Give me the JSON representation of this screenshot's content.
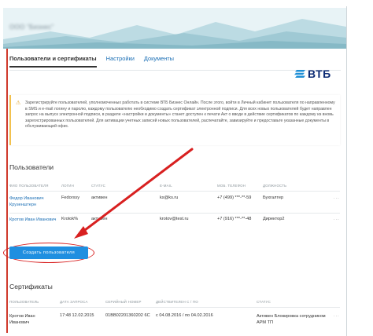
{
  "banner": {
    "title": "ООО \"Бизнес\""
  },
  "tabs": [
    {
      "label": "Пользователи и сертификаты",
      "active": true
    },
    {
      "label": "Настройки",
      "active": false
    },
    {
      "label": "Документы",
      "active": false
    }
  ],
  "logo": {
    "text": "ВТБ",
    "icon": "vtb-stripes-icon"
  },
  "notice": {
    "icon": "warning-icon",
    "text": "Зарегистрируйте пользователей, уполномоченных работать в системе ВТБ Бизнес Онлайн. После этого, войти в Личный кабинет пользователя по направленному в SMS и e-mail логину и паролю, каждому пользователю необходимо создать сертификат электронной подписи. Для всех новых пользователей будет направлен запрос на выпуск электронной подписи, в разделе «настройки и документы» станет доступен к печати Акт о вводе в действие сертификатов по каждому из вновь зарегистрированных пользователей. Для активации учетных записей новых пользователей, распечатайте, завизируйте и предоставьте указанные документы в обслуживающий офис."
  },
  "users": {
    "title": "Пользователи",
    "columns": [
      "ФИО пользователя",
      "Логин",
      "Статус",
      "E-mail",
      "Моб. телефон",
      "Должность"
    ],
    "rows": [
      {
        "name": "Федор Иванович Крузенштерн",
        "login": "Fedorxsy",
        "status": "активен",
        "email": "ks@ks.ru",
        "phone": "+7 (499) ***-**-59",
        "position": "Бухгалтер"
      },
      {
        "name": "Кротов Иван Иванович",
        "login": "Krotok%",
        "status": "активен",
        "email": "krotov@test.ru",
        "phone": "+7 (916) ***-**-48",
        "position": "Директор2"
      }
    ],
    "more": "...",
    "create_button": "Создать пользователя"
  },
  "certs": {
    "title": "Сертификаты",
    "columns": [
      "Пользователь",
      "Дата запроса",
      "Серийный номер",
      "Действителен с / по",
      "Статус"
    ],
    "rows": [
      {
        "user": "Кротов Иван Иванович",
        "date": "17:48 12.02.2015",
        "serial": "01BB02201360202 6C",
        "valid": "c 04.08.2016 / по 04.02.2016",
        "status": "Активен Блокировка сотрудником АРМ ТП"
      }
    ],
    "more": "..."
  }
}
